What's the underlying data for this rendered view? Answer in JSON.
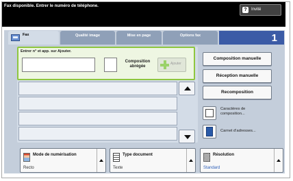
{
  "status_message": "Fax disponible. Entrer le numéro de téléphone.",
  "user_button": {
    "icon": "help-icon",
    "label": "Invité"
  },
  "tabs": [
    {
      "label": "Fax",
      "active": true
    },
    {
      "label": "Qualité image",
      "active": false
    },
    {
      "label": "Mise en page",
      "active": false
    },
    {
      "label": "Options fax",
      "active": false
    }
  ],
  "quantity": "1",
  "entry": {
    "label": "Entrer n° et app. sur Ajouter.",
    "value": "",
    "abbreviated_label": "Composition abrégée",
    "add_label": "Ajouter"
  },
  "recipient_list": [
    "",
    "",
    "",
    ""
  ],
  "right_buttons": {
    "manual_dial": "Composition manuelle",
    "manual_receive": "Réception manuelle",
    "redial": "Recomposition",
    "dial_chars": "Caractères de composition...",
    "address_book": "Carnet d'adresses..."
  },
  "bottom": {
    "scan_mode": {
      "title": "Mode de numérisation",
      "value": "Recto"
    },
    "doc_type": {
      "title": "Type document",
      "value": "Texte"
    },
    "resolution": {
      "title": "Résolution",
      "value": "Standard"
    }
  },
  "colors": {
    "header_bg": "#000000",
    "panel_bg": "#c4cedb",
    "accent_blue": "#3b5ba6",
    "entry_green": "#8ec63f"
  }
}
